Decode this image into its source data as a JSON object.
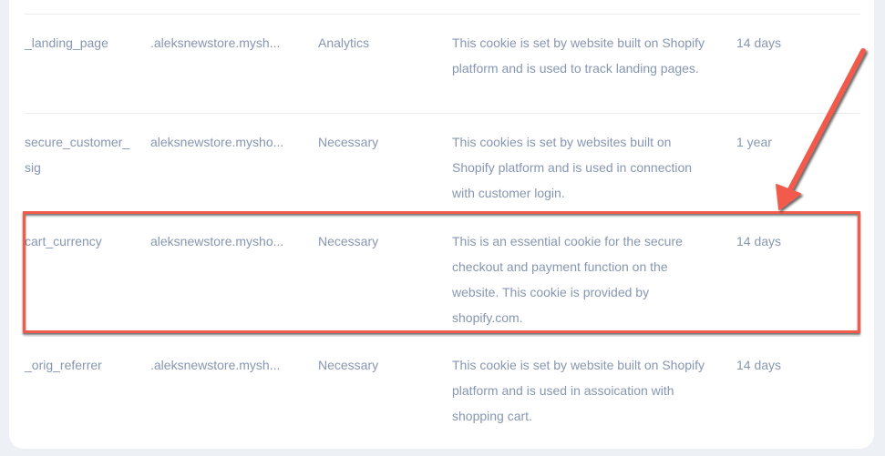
{
  "rows": [
    {
      "name": "_landing_page",
      "domain": ".aleksnewstore.mysh...",
      "category": "Analytics",
      "description": "This cookie is set by website built on Shopify platform and is used to track landing pages.",
      "duration": "14 days"
    },
    {
      "name": "secure_customer_sig",
      "domain": "aleksnewstore.mysho...",
      "category": "Necessary",
      "description": "This cookies is set by websites built on Shopify platform and is used in connection with customer login.",
      "duration": "1 year"
    },
    {
      "name": "cart_currency",
      "domain": "aleksnewstore.mysho...",
      "category": "Necessary",
      "description": "This is an essential cookie for the secure checkout and payment function on the website. This cookie is provided by shopify.com.",
      "duration": "14 days"
    },
    {
      "name": "_orig_referrer",
      "domain": ".aleksnewstore.mysh...",
      "category": "Necessary",
      "description": "This cookie is set by website built on Shopify platform and is used in assoication with shopping cart.",
      "duration": "14 days"
    }
  ],
  "annotation": {
    "highlight_color": "#f25a4b",
    "highlighted_row": "cart_currency"
  }
}
